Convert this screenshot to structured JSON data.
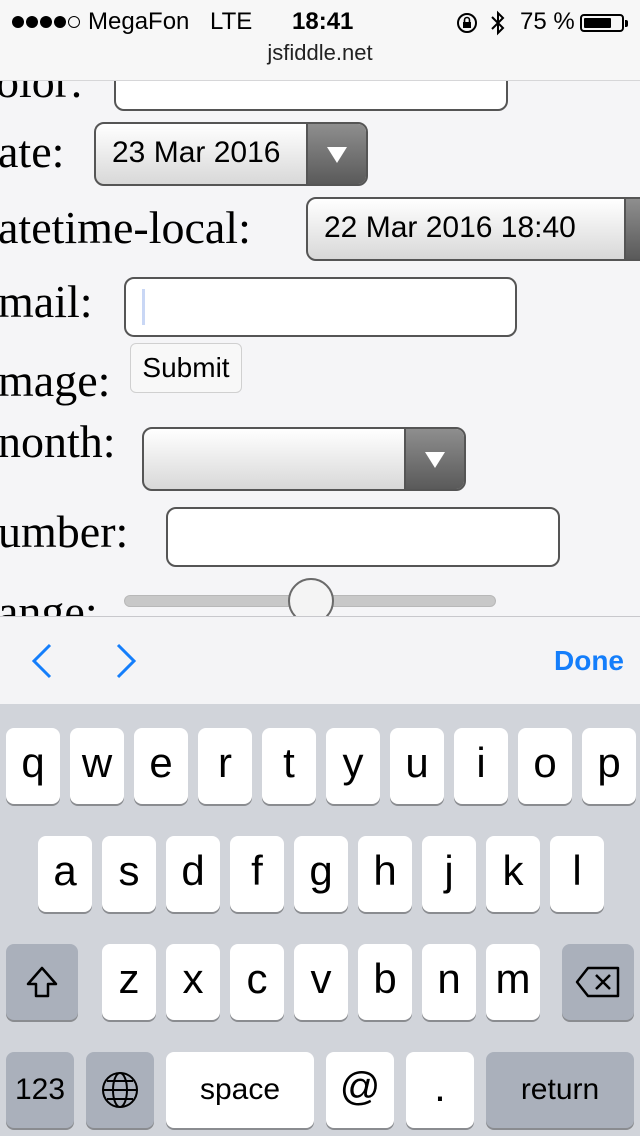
{
  "status_bar": {
    "carrier": "MegaFon",
    "network": "LTE",
    "time": "18:41",
    "battery_percent": "75 %",
    "battery_level": 0.75,
    "signal_bars": 4,
    "icons": [
      "rotation-lock-icon",
      "bluetooth-icon",
      "battery-icon"
    ]
  },
  "browser": {
    "url": "jsfiddle.net"
  },
  "form": {
    "labels": {
      "color": "olor:",
      "date": "ate:",
      "datetime_local": "atetime-local:",
      "email": "mail:",
      "image": "mage:",
      "month": "nonth:",
      "number": "umber:",
      "range": "ange:"
    },
    "date_value": "23 Mar 2016",
    "datetime_value": "22 Mar 2016 18:40",
    "month_value": "",
    "email_value": "",
    "number_value": "",
    "submit_label": "Submit",
    "range_value": 0.5
  },
  "accessory_bar": {
    "prev_icon": "chevron-left-icon",
    "next_icon": "chevron-right-icon",
    "done_label": "Done"
  },
  "keyboard": {
    "row1": [
      "q",
      "w",
      "e",
      "r",
      "t",
      "y",
      "u",
      "i",
      "o",
      "p"
    ],
    "row2": [
      "a",
      "s",
      "d",
      "f",
      "g",
      "h",
      "j",
      "k",
      "l"
    ],
    "row3": [
      "z",
      "x",
      "c",
      "v",
      "b",
      "n",
      "m"
    ],
    "numbers_label": "123",
    "space_label": "space",
    "at_label": "@",
    "dot_label": ".",
    "return_label": "return",
    "shift_icon": "shift-icon",
    "delete_icon": "backspace-icon",
    "globe_icon": "globe-icon"
  },
  "colors": {
    "accent": "#147efb",
    "keyboard_bg": "#d1d4da",
    "dark_key": "#aab0bb"
  }
}
